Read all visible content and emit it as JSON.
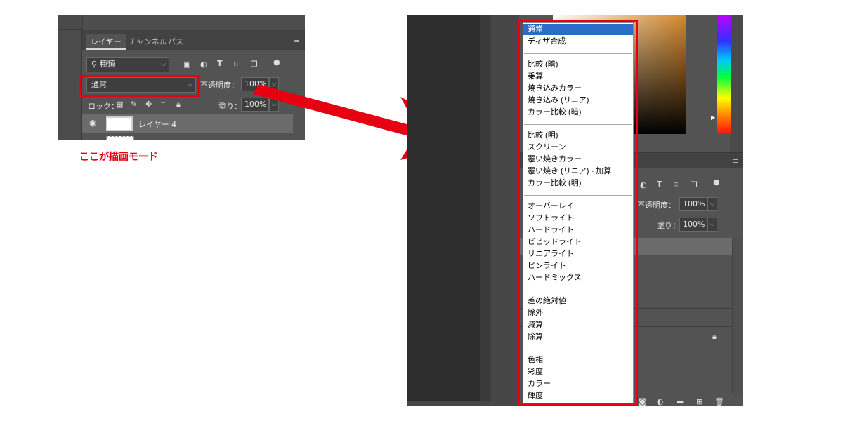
{
  "left_panel": {
    "tabs": [
      {
        "label": "レイヤー",
        "active": true
      },
      {
        "label": "チャンネル",
        "active": false
      },
      {
        "label": "パス",
        "active": false
      }
    ],
    "filter_label": "種類",
    "blend_mode": "通常",
    "opacity_label": "不透明度：",
    "opacity_value": "100%",
    "lock_label": "ロック：",
    "fill_label": "塗り：",
    "fill_value": "100%",
    "layer_name": "レイヤー 4"
  },
  "caption": "ここが描画モード",
  "right_panel": {
    "opacity_label": "不透明度：",
    "opacity_value": "100%",
    "fill_label": "塗り：",
    "fill_value": "100%"
  },
  "blend_modes": {
    "groups": [
      [
        "通常",
        "ディザ合成"
      ],
      [
        "比較 (暗)",
        "乗算",
        "焼き込みカラー",
        "焼き込み (リニア)",
        "カラー比較 (暗)"
      ],
      [
        "比較 (明)",
        "スクリーン",
        "覆い焼きカラー",
        "覆い焼き (リニア) - 加算",
        "カラー比較 (明)"
      ],
      [
        "オーバーレイ",
        "ソフトライト",
        "ハードライト",
        "ビビッドライト",
        "リニアライト",
        "ピンライト",
        "ハードミックス"
      ],
      [
        "差の絶対値",
        "除外",
        "減算",
        "除算"
      ],
      [
        "色相",
        "彩度",
        "カラー",
        "輝度"
      ]
    ],
    "selected": "通常"
  },
  "colors": {
    "highlight_red": "#e60012",
    "selection_blue": "#2a6cc6",
    "panel_gray": "#535353"
  }
}
